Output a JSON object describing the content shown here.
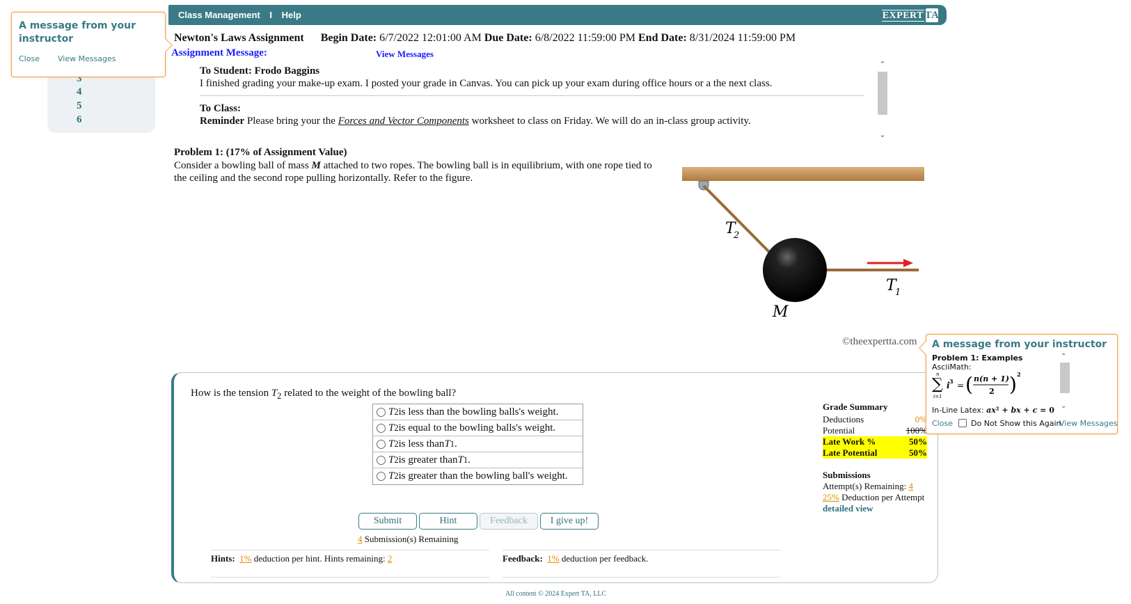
{
  "topbar": {
    "menu_class_management": "Class Management",
    "menu_separator": "I",
    "menu_help": "Help",
    "logo_text": "EXPERT",
    "logo_mark": "TA",
    "color": "#3a7a86"
  },
  "assignment": {
    "name": "Newton's Laws Assignment",
    "begin_label": "Begin Date:",
    "begin_value": "6/7/2022 12:01:00 AM",
    "due_label": "Due Date:",
    "due_value": "6/8/2022 11:59:00 PM",
    "end_label": "End Date:",
    "end_value": "8/31/2024 11:59:00 PM",
    "message_label": "Assignment Message:",
    "view_messages": "View Messages"
  },
  "leftnav": {
    "items": [
      "3",
      "4",
      "5",
      "6"
    ]
  },
  "messages": {
    "student_heading": "To Student: Frodo Baggins",
    "student_text": "I finished grading your make-up exam. I posted your grade in Canvas. You can pick up your exam during office hours or a the next class.",
    "class_heading": "To Class:",
    "class_reminder_label": "Reminder",
    "class_text_before": " Please bring your the ",
    "class_link": "Forces and Vector Components",
    "class_text_after": " worksheet to class on Friday. We will do an in-class group activity."
  },
  "problem": {
    "title": "Problem 1: (17% of Assignment Value)",
    "text_before": " Consider a bowling ball of mass ",
    "mass_symbol": "M",
    "text_after": " attached to two ropes. The bowling ball is in equilibrium, with one rope tied to the ceiling and the second rope pulling horizontally. Refer to the figure.",
    "figure_labels": {
      "t2": "T",
      "t2_sub": "2",
      "t1": "T",
      "t1_sub": "1",
      "mass": "M"
    },
    "copyright": "©theexpertta.com"
  },
  "question": {
    "text_before": "How is the tension ",
    "symbol": "T",
    "symbol_sub": "2",
    "text_after": " related to the weight of the bowling ball?",
    "choices": [
      {
        "sym": "T",
        "sub": "2",
        "text": " is less than the bowling balls's weight.",
        "sym2": "",
        "sub2": "",
        "end": ""
      },
      {
        "sym": "T",
        "sub": "2",
        "text": " is equal to the bowling balls's weight.",
        "sym2": "",
        "sub2": "",
        "end": ""
      },
      {
        "sym": "T",
        "sub": "2",
        "text": " is less than ",
        "sym2": "T",
        "sub2": "1",
        "end": "."
      },
      {
        "sym": "T",
        "sub": "2",
        "text": " is greater than ",
        "sym2": "T",
        "sub2": "1",
        "end": "."
      },
      {
        "sym": "T",
        "sub": "2",
        "text": " is greater than the bowling ball's weight.",
        "sym2": "",
        "sub2": "",
        "end": ""
      }
    ],
    "buttons": {
      "submit": "Submit",
      "hint": "Hint",
      "feedback": "Feedback",
      "give_up": "I give up!"
    },
    "submissions_count": "4",
    "submissions_label": " Submission(s) Remaining",
    "hints_label": "Hints:",
    "hints_pct": "1%",
    "hints_mid": " deduction per hint. Hints remaining: ",
    "hints_remaining": "2",
    "feedback_label": "Feedback:",
    "feedback_pct": "1%",
    "feedback_mid": " deduction per feedback."
  },
  "grade_summary": {
    "title": "Grade Summary",
    "deductions_label": "Deductions",
    "deductions_value": "0%",
    "potential_label": "Potential",
    "potential_value": "100%",
    "late_work_label": "Late Work %",
    "late_work_value": "50%",
    "late_potential_label": "Late Potential",
    "late_potential_value": "50%",
    "submissions_title": "Submissions",
    "attempts_label": "Attempt(s) Remaining: ",
    "attempts_value": "4",
    "deduction_pct": "25%",
    "deduction_label": " Deduction per Attempt",
    "detailed_view": "detailed view"
  },
  "footer": "All content © 2024 Expert TA, LLC",
  "popup_left": {
    "title": "A message from your instructor",
    "close": "Close",
    "view_messages": "View Messages"
  },
  "popup_right": {
    "title": "A message from your instructor",
    "line1": "Problem 1: Examples",
    "line2": "AsciiMath:",
    "inline_label": "In-Line Latex: ",
    "close": "Close",
    "do_not_show": "Do Not Show this Again",
    "view_messages": "View Messages"
  }
}
